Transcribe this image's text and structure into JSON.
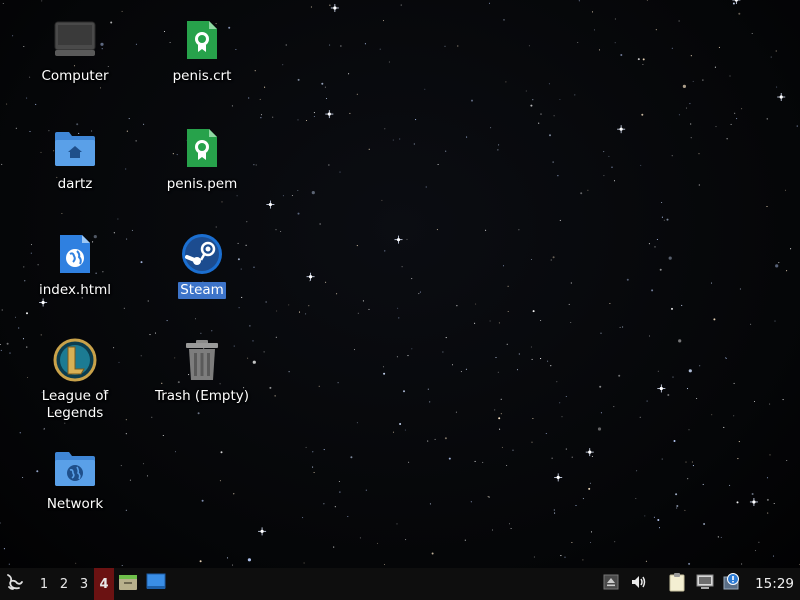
{
  "desktop": {
    "icons": [
      {
        "label": "Computer",
        "icon": "computer-icon"
      },
      {
        "label": "penis.crt",
        "icon": "certificate-file-icon"
      },
      {
        "label": "dartz",
        "icon": "home-folder-icon"
      },
      {
        "label": "penis.pem",
        "icon": "certificate-file-icon"
      },
      {
        "label": "index.html",
        "icon": "html-file-icon"
      },
      {
        "label": "Steam",
        "icon": "steam-icon",
        "selected": true
      },
      {
        "label": "League of\nLegends",
        "icon": "league-of-legends-icon"
      },
      {
        "label": "Trash (Empty)",
        "icon": "trash-icon"
      },
      {
        "label": "Network",
        "icon": "network-folder-icon"
      }
    ]
  },
  "taskbar": {
    "menu_icon": "lxqt-menu-icon",
    "workspaces": [
      "1",
      "2",
      "3",
      "4"
    ],
    "active_workspace": "4",
    "quicklaunch": [
      "file-manager-icon",
      "show-desktop-icon"
    ],
    "tray": [
      "eject-icon",
      "volume-icon",
      "clipboard-icon",
      "network-icon",
      "update-notifier-icon"
    ],
    "clock": "15:29"
  },
  "colors": {
    "selection": "#3d74c9",
    "active_workspace": "#6b1212",
    "taskbar_bg": "#0e0e0e"
  }
}
